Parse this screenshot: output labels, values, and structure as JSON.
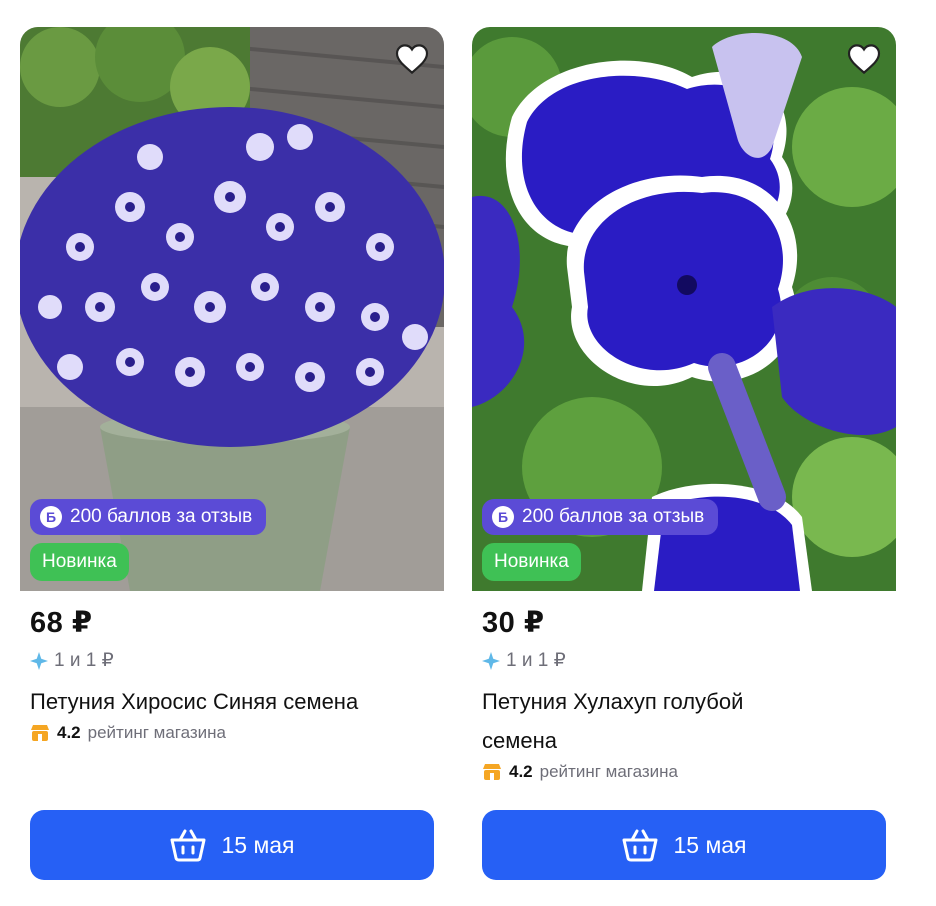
{
  "products": [
    {
      "badge_points": "200 баллов за отзыв",
      "badge_points_icon": "Б",
      "badge_new": "Новинка",
      "price": "68 ₽",
      "promo": "1 и 1 ₽",
      "title": "Петуния Хиросис Синяя семена",
      "rating_value": "4.2",
      "rating_label": "рейтинг магазина",
      "button_label": "15 мая",
      "image": "Purple and white star-patterned petunias in a pot"
    },
    {
      "badge_points": "200 баллов за отзыв",
      "badge_points_icon": "Б",
      "badge_new": "Новинка",
      "price": "30 ₽",
      "promo": "1 и 1 ₽",
      "title": "Петуния Хулахуп голубой семена",
      "rating_value": "4.2",
      "rating_label": "рейтинг магазина",
      "button_label": "15 мая",
      "image": "Close-up of dark blue petunias with white ruffled edges"
    }
  ],
  "colors": {
    "points_badge": "#5b4bd6",
    "new_badge": "#3fc155",
    "button": "#2660f5",
    "rating_icon": "#f5a623",
    "promo_icon": "#5fb8e8"
  }
}
